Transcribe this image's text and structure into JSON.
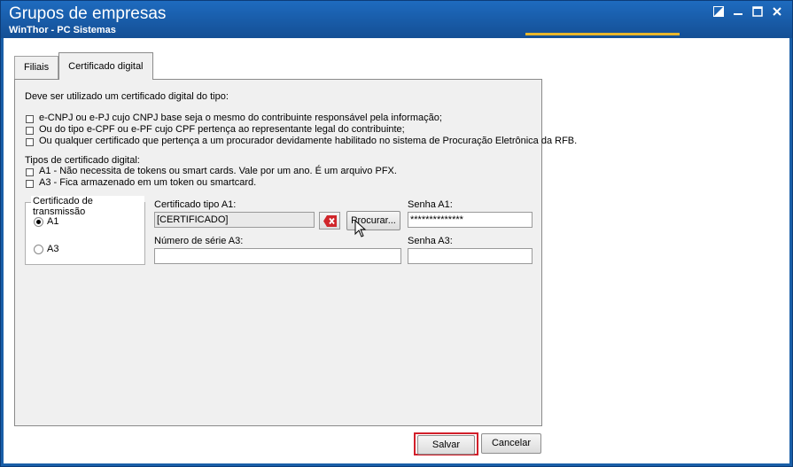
{
  "window": {
    "title": "Grupos de empresas",
    "subtitle": "WinThor - PC Sistemas",
    "controls": [
      "restore-icon",
      "minimize-icon",
      "maximize-icon",
      "close-icon"
    ]
  },
  "tabs": [
    {
      "label": "Filiais",
      "active": false
    },
    {
      "label": "Certificado digital",
      "active": true
    }
  ],
  "content": {
    "intro": "Deve ser utilizado um certificado digital do tipo:",
    "requirements": [
      "e-CNPJ ou e-PJ cujo CNPJ base seja o mesmo do contribuinte responsável pela informação;",
      "Ou do tipo e-CPF ou e-PF cujo CPF pertença ao representante legal do contribuinte;",
      "Ou qualquer certificado que pertença a um procurador devidamente habilitado no sistema de Procuração Eletrônica da RFB."
    ],
    "types_heading": "Tipos de certificado digital:",
    "types": [
      "A1 - Não necessita de tokens ou smart cards. Vale por um ano. É um arquivo PFX.",
      "A3 - Fica armazenado em um token ou smartcard."
    ]
  },
  "transmission": {
    "label": "Certificado de transmissão",
    "options": [
      {
        "label": "A1",
        "selected": true
      },
      {
        "label": "A3",
        "selected": false
      }
    ]
  },
  "fields": {
    "cert_a1_label": "Certificado tipo A1:",
    "cert_a1_value": "[CERTIFICADO]",
    "browse_label": "Procurar...",
    "senha_a1_label": "Senha A1:",
    "senha_a1_value": "**************",
    "serial_a3_label": "Número de série A3:",
    "serial_a3_value": "",
    "senha_a3_label": "Senha A3:",
    "senha_a3_value": ""
  },
  "footer": {
    "save_label": "Salvar",
    "cancel_label": "Cancelar"
  },
  "colors": {
    "title_bar": "#185aa5",
    "accent_line": "#e8b62c",
    "highlight": "#d21f2a"
  }
}
